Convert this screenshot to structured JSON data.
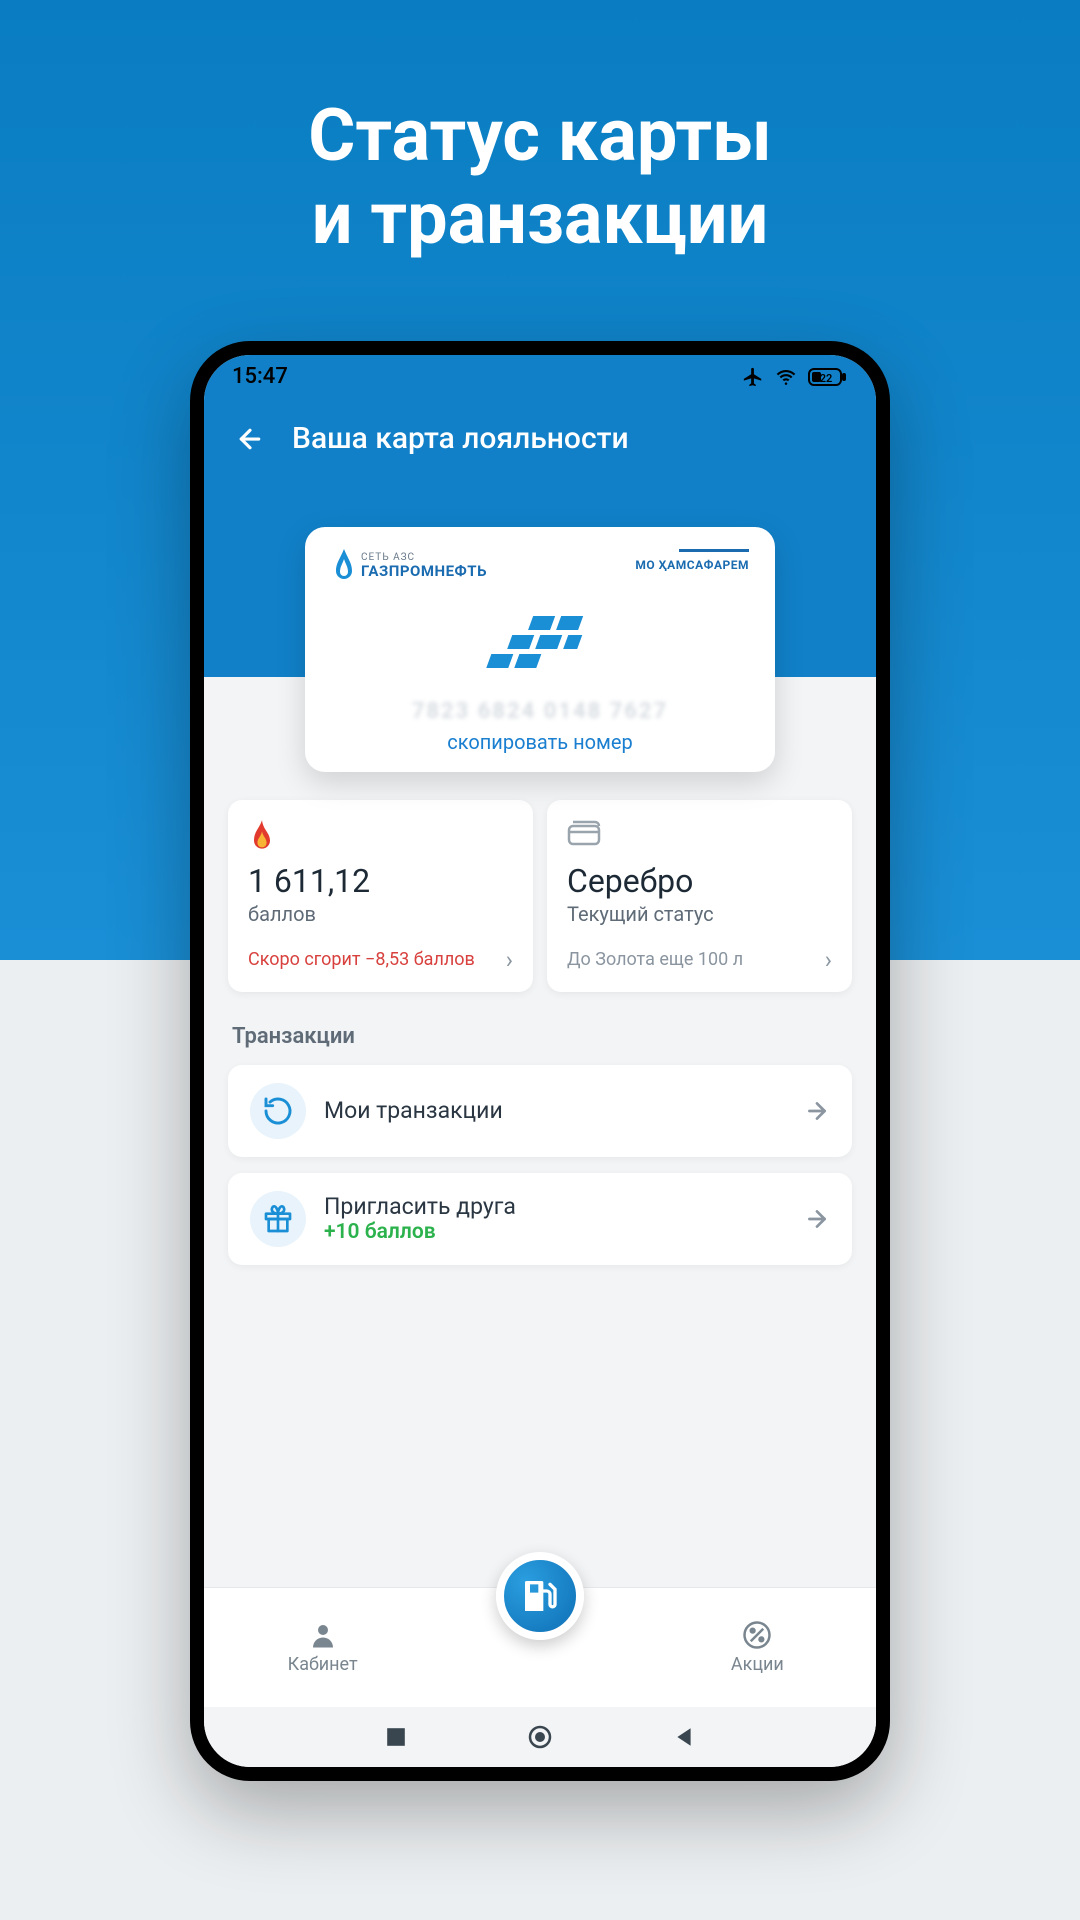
{
  "hero": {
    "line1": "Статус карты",
    "line2": "и транзакции"
  },
  "status": {
    "time": "15:47",
    "battery": "22"
  },
  "header": {
    "title": "Ваша карта лояльности"
  },
  "card": {
    "brand_small": "СЕТЬ АЗС",
    "brand_main": "ГАЗПРОМНЕФТЬ",
    "partner": "МО ҲАМСАФАРЕМ",
    "copy_label": "скопировать номер"
  },
  "points": {
    "value": "1 611,12",
    "unit": "баллов",
    "expiring": "Скоро сгорит −8,53 баллов"
  },
  "status_card": {
    "value": "Серебро",
    "label": "Текущий статус",
    "next": "До Золота еще 100 л"
  },
  "section": {
    "transactions": "Транзакции"
  },
  "rows": {
    "my_transactions": "Мои транзакции",
    "invite": "Пригласить друга",
    "invite_bonus": "+10 баллов"
  },
  "nav": {
    "cabinet": "Кабинет",
    "promo": "Акции"
  }
}
